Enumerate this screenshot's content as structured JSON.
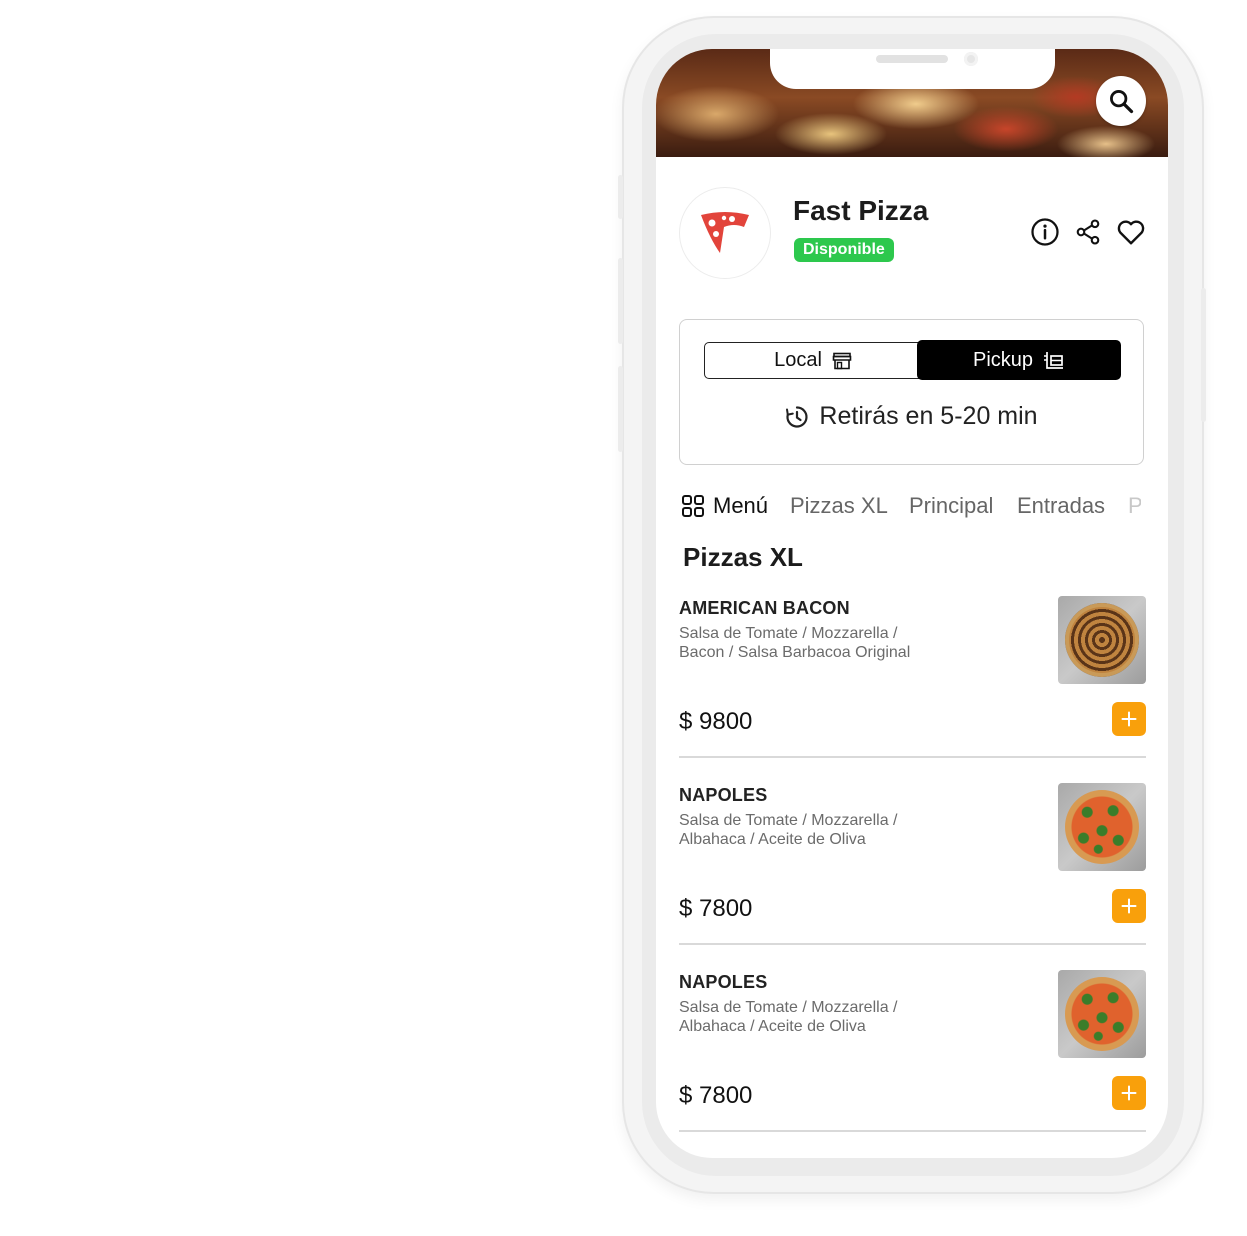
{
  "app": {
    "title": "Fast Pizza",
    "status_badge": "Disponible",
    "brand_color": "#e2443b",
    "status_color": "#2dc84d",
    "accent_color": "#f9a00b"
  },
  "header": {
    "icons": [
      "info-icon",
      "share-icon",
      "heart-icon"
    ],
    "search_icon": "search-icon"
  },
  "order_mode": {
    "options": [
      {
        "label": "Local",
        "icon": "store-icon",
        "selected": false
      },
      {
        "label": "Pickup",
        "icon": "pickup-icon",
        "selected": true
      }
    ],
    "eta_text": "Retirás en 5-20 min"
  },
  "tabs": [
    {
      "label": "Menú",
      "icon": "grid-icon",
      "active": true
    },
    {
      "label": "Pizzas XL",
      "active": false
    },
    {
      "label": "Principal",
      "active": false
    },
    {
      "label": "Entradas",
      "active": false
    },
    {
      "label": "P",
      "active": false
    }
  ],
  "section": {
    "title": "Pizzas XL",
    "items": [
      {
        "name": "AMERICAN BACON",
        "desc_line1": "Salsa de Tomate / Mozzarella /",
        "desc_line2": "Bacon / Salsa Barbacoa Original",
        "price": "$ 9800"
      },
      {
        "name": "NAPOLES",
        "desc_line1": "Salsa de Tomate / Mozzarella /",
        "desc_line2": "Albahaca / Aceite de Oliva",
        "price": "$ 7800"
      },
      {
        "name": "NAPOLES",
        "desc_line1": "Salsa de Tomate / Mozzarella /",
        "desc_line2": "Albahaca / Aceite de Oliva",
        "price": "$ 7800"
      }
    ]
  }
}
